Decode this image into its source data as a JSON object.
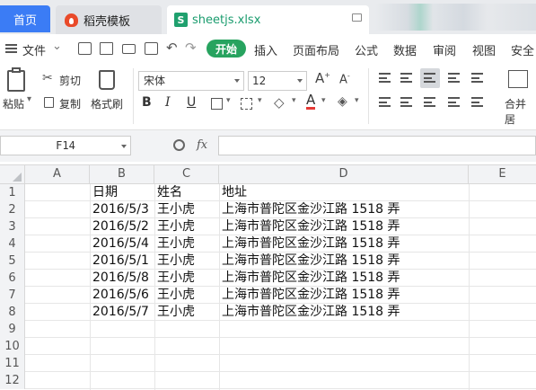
{
  "tabs": {
    "home": "首页",
    "template": "稻壳模板",
    "file": "sheetjs.xlsx",
    "sheet_icon_letter": "S"
  },
  "menu": {
    "file": "文件",
    "start": "开始",
    "insert": "插入",
    "page_layout": "页面布局",
    "formula": "公式",
    "data": "数据",
    "review": "审阅",
    "view": "视图",
    "security": "安全"
  },
  "ribbon": {
    "paste": "粘贴",
    "cut": "剪切",
    "copy": "复制",
    "format_painter": "格式刷",
    "font_name": "宋体",
    "font_size": "12",
    "bold": "B",
    "italic": "I",
    "underline": "U",
    "merge": "合并居"
  },
  "formula_bar": {
    "cell_ref": "F14",
    "fx": "fx",
    "value": ""
  },
  "sheet": {
    "columns": [
      "A",
      "B",
      "C",
      "D",
      "E"
    ],
    "row_numbers": [
      "1",
      "2",
      "3",
      "4",
      "5",
      "6",
      "7",
      "8",
      "9",
      "10",
      "11",
      "12"
    ],
    "rows": [
      [
        "",
        "日期",
        "姓名",
        "地址"
      ],
      [
        "",
        "2016/5/3",
        "王小虎",
        "上海市普陀区金沙江路 1518 弄"
      ],
      [
        "",
        "2016/5/2",
        "王小虎",
        "上海市普陀区金沙江路 1518 弄"
      ],
      [
        "",
        "2016/5/4",
        "王小虎",
        "上海市普陀区金沙江路 1518 弄"
      ],
      [
        "",
        "2016/5/1",
        "王小虎",
        "上海市普陀区金沙江路 1518 弄"
      ],
      [
        "",
        "2016/5/8",
        "王小虎",
        "上海市普陀区金沙江路 1518 弄"
      ],
      [
        "",
        "2016/5/6",
        "王小虎",
        "上海市普陀区金沙江路 1518 弄"
      ],
      [
        "",
        "2016/5/7",
        "王小虎",
        "上海市普陀区金沙江路 1518 弄"
      ]
    ]
  },
  "colors": {
    "accent_blue": "#3b7cf5",
    "start_green": "#27a35f",
    "sheet_green": "#1fa06e"
  }
}
